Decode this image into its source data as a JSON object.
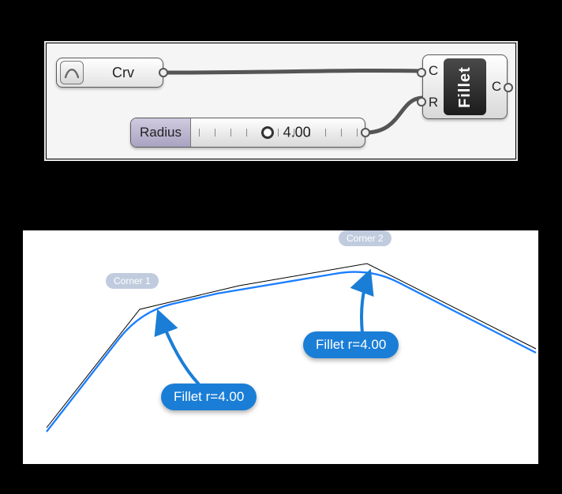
{
  "gh": {
    "crv_label": "Crv",
    "slider_label": "Radius",
    "slider_value": "4.00",
    "fillet_title": "Fillet",
    "fillet_in1": "C",
    "fillet_in2": "R",
    "fillet_out": "C"
  },
  "viewport": {
    "corner1_label": "Corner 1",
    "corner2_label": "Corner 2",
    "callout1": "Fillet r=4.00",
    "callout2": "Fillet r=4.00",
    "radius_value": 4.0
  }
}
